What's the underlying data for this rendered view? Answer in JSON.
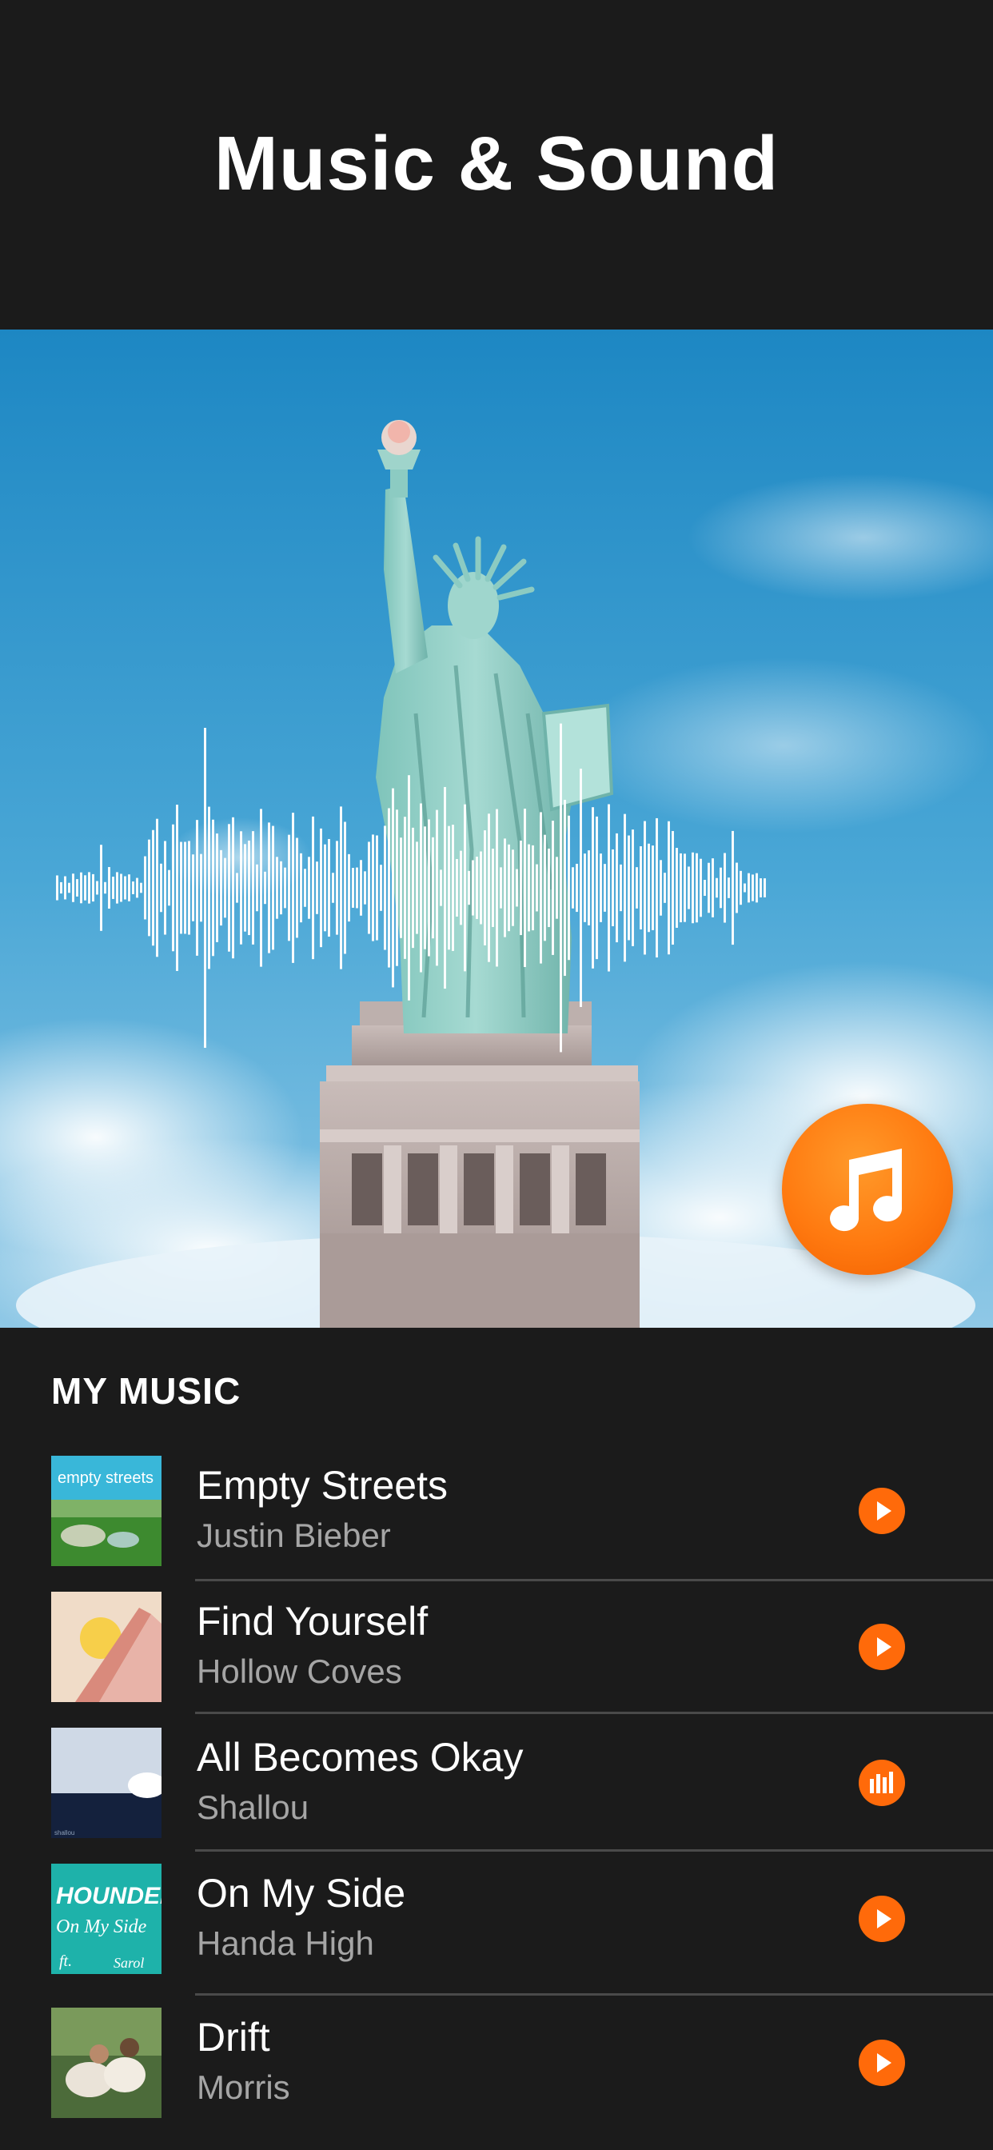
{
  "header": {
    "title": "Music & Sound"
  },
  "section": {
    "title": "MY MUSIC"
  },
  "tracks": [
    {
      "title": "Empty Streets",
      "artist": "Justin Bieber",
      "state": "play",
      "art_text": "empty streets"
    },
    {
      "title": "Find Yourself",
      "artist": "Hollow  Coves",
      "state": "play",
      "art_text": ""
    },
    {
      "title": "All Becomes Okay",
      "artist": "Shallou",
      "state": "playing",
      "art_text": "shallou"
    },
    {
      "title": "On My Side",
      "artist": "Handa High",
      "state": "play",
      "art_text": "HOUNDED On My Side ft. Sarol"
    },
    {
      "title": "Drift",
      "artist": "Morris",
      "state": "play",
      "art_text": ""
    }
  ],
  "colors": {
    "background": "#1b1b1b",
    "accent": "#ff6a0a",
    "secondary_text": "#a5a5a5",
    "divider": "#4a4a4a"
  },
  "icons": {
    "fab": "music-note-icon",
    "play": "play-icon",
    "playing": "equalizer-icon"
  }
}
